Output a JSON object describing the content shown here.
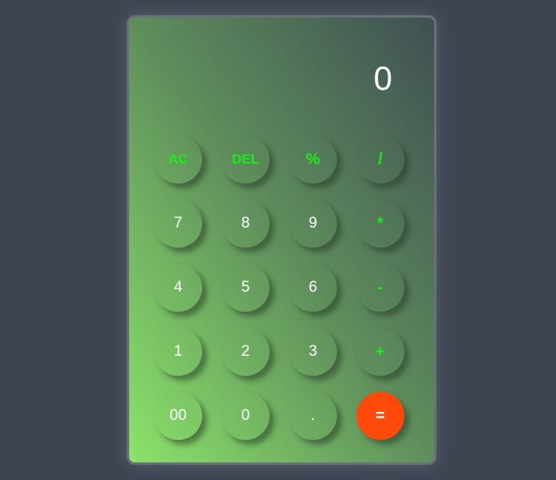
{
  "display": {
    "value": "0"
  },
  "buttons": {
    "ac": "AC",
    "del": "DEL",
    "percent": "%",
    "divide": "/",
    "seven": "7",
    "eight": "8",
    "nine": "9",
    "multiply": "*",
    "four": "4",
    "five": "5",
    "six": "6",
    "subtract": "-",
    "one": "1",
    "two": "2",
    "three": "3",
    "add": "+",
    "double_zero": "00",
    "zero": "0",
    "decimal": ".",
    "equals": "="
  },
  "colors": {
    "page_background": "#3d4553",
    "operator_text": "#19ee19",
    "equals_button": "#ff4a0b",
    "digit_text": "#ffffff"
  }
}
